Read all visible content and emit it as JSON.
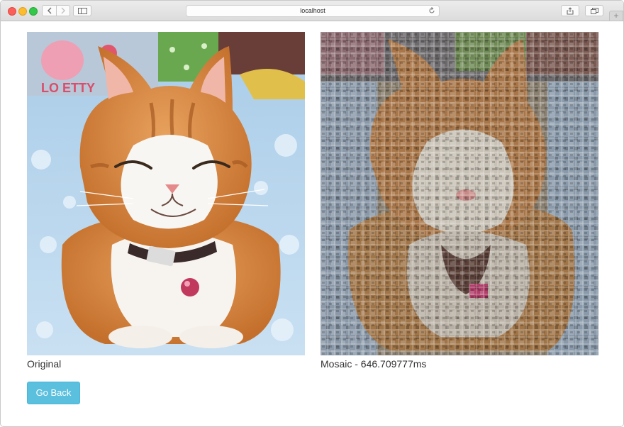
{
  "browser": {
    "address": "localhost",
    "icons": {
      "back": "chevron-left-icon",
      "forward": "chevron-right-icon",
      "sidebar": "sidebar-icon",
      "reload": "reload-icon",
      "share": "share-icon",
      "tabs": "tabs-icon",
      "new_tab": "plus-icon"
    }
  },
  "figures": {
    "original_caption": "Original",
    "mosaic_caption": "Mosaic - 646.709777ms"
  },
  "actions": {
    "go_back_label": "Go Back",
    "go_back_color": "#5bc0de"
  }
}
